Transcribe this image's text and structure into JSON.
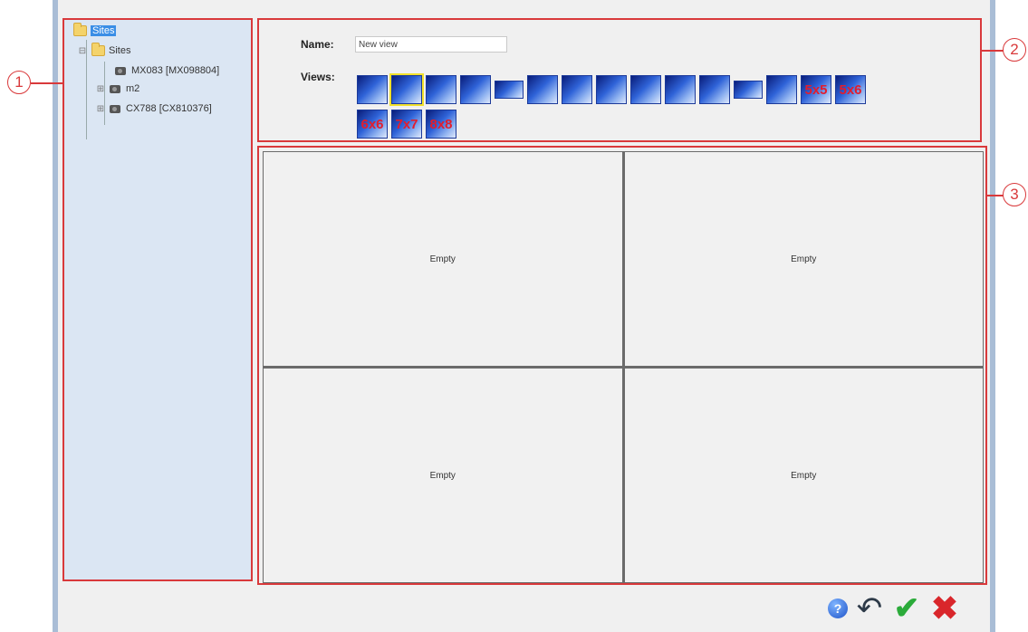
{
  "tree": {
    "root_label": "Sites",
    "sites_label": "Sites",
    "items": [
      {
        "label": "MX083 [MX098804]"
      },
      {
        "label": "m2"
      },
      {
        "label": "CX788 [CX810376]"
      }
    ]
  },
  "form": {
    "name_label": "Name:",
    "name_value": "New view",
    "views_label": "Views:"
  },
  "layouts": [
    {
      "name": "1x1"
    },
    {
      "name": "2x2",
      "selected": true
    },
    {
      "name": "1+5"
    },
    {
      "name": "1+7"
    },
    {
      "name": "strip"
    },
    {
      "name": "2+8"
    },
    {
      "name": "1+12"
    },
    {
      "name": "4x4"
    },
    {
      "name": "1+15"
    },
    {
      "name": "5x4"
    },
    {
      "name": "2+16"
    },
    {
      "name": "strip-wide"
    },
    {
      "name": "5x5-grid"
    },
    {
      "label": "5x5"
    },
    {
      "label": "5x6"
    },
    {
      "label": "6x6"
    },
    {
      "label": "7x7"
    },
    {
      "label": "8x8"
    }
  ],
  "cells": [
    {
      "label": "Empty"
    },
    {
      "label": "Empty"
    },
    {
      "label": "Empty"
    },
    {
      "label": "Empty"
    }
  ],
  "callouts": [
    "1",
    "2",
    "3"
  ],
  "footer": {
    "help_icon": "?",
    "undo_icon": "undo-icon",
    "ok_icon": "check-icon",
    "cancel_icon": "close-icon"
  },
  "colors": {
    "callout": "#d9393b",
    "tree_bg": "#dbe6f3",
    "selected_layout_outline": "#f2e12a",
    "ok": "#2bab3a",
    "cancel": "#d9262b"
  }
}
